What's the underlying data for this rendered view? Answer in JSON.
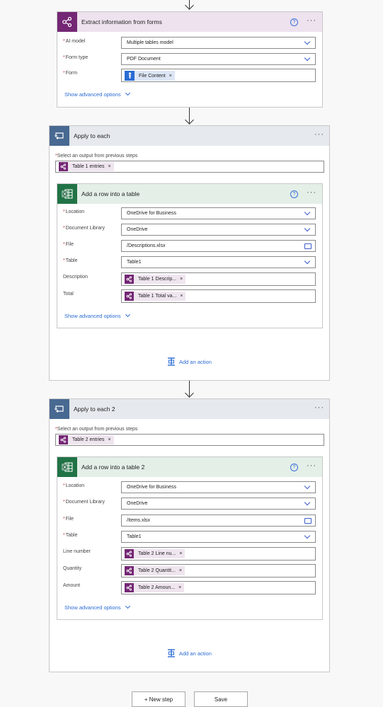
{
  "colors": {
    "ai_purple": "#742774",
    "loop_blue": "#486991",
    "excel_green": "#217346",
    "link_blue": "#2b6cd4"
  },
  "extract": {
    "title": "Extract information from forms",
    "icon": "ai-builder-icon",
    "fields": [
      {
        "label": "AI model",
        "value": "Multiple tables model"
      },
      {
        "label": "Form type",
        "value": "PDF Document"
      },
      {
        "label": "Form",
        "token": "File Content"
      }
    ],
    "advanced": "Show advanced options"
  },
  "loop1": {
    "title": "Apply to each",
    "select_label": "Select an output from previous steps",
    "select_token": "Table 1 entries",
    "inner": {
      "title": "Add a row into a table",
      "fields": [
        {
          "label": "Location",
          "value": "OneDrive for Business"
        },
        {
          "label": "Document Library",
          "value": "OneDrive"
        },
        {
          "label": "File",
          "value": "/Descriptions.xlsx"
        },
        {
          "label": "Table",
          "value": "Table1"
        },
        {
          "label": "Description",
          "token": "Table 1 Descrip..."
        },
        {
          "label": "Total",
          "token": "Table 1 Total va..."
        }
      ],
      "advanced": "Show advanced options"
    },
    "add_action": "Add an action"
  },
  "loop2": {
    "title": "Apply to each 2",
    "select_label": "Select an output from previous steps",
    "select_token": "Table 2 entries",
    "inner": {
      "title": "Add a row into a table 2",
      "fields": [
        {
          "label": "Location",
          "value": "OneDrive for Business"
        },
        {
          "label": "Document Library",
          "value": "OneDrive"
        },
        {
          "label": "File",
          "value": "/Items.xlsx"
        },
        {
          "label": "Table",
          "value": "Table1"
        },
        {
          "label": "Line number",
          "token": "Table 2 Line nu..."
        },
        {
          "label": "Quantity",
          "token": "Table 2 Quantit..."
        },
        {
          "label": "Amount",
          "token": "Table 2 Amoun..."
        }
      ],
      "advanced": "Show advanced options"
    },
    "add_action": "Add an action"
  },
  "footer": {
    "new_step": "+ New step",
    "save": "Save"
  },
  "glyphs": {
    "help": "?",
    "more": "···",
    "remove": "×",
    "required": "*"
  }
}
